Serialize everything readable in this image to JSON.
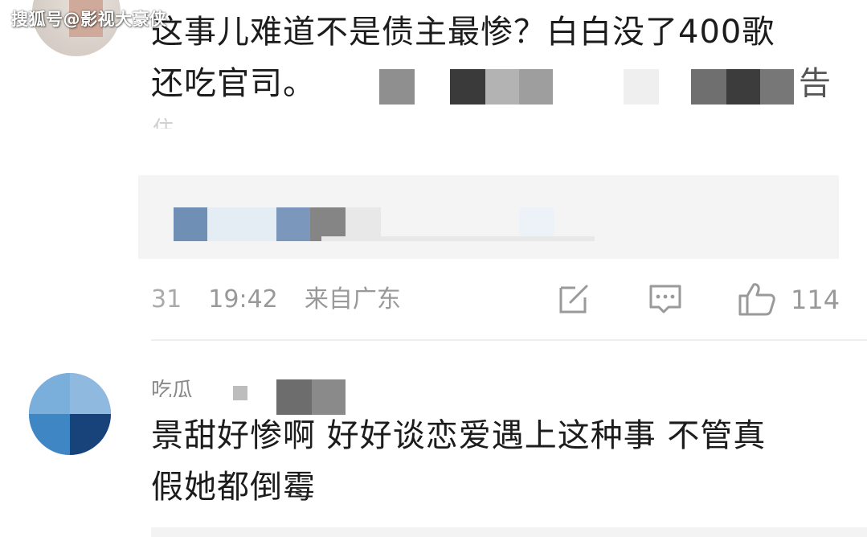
{
  "watermark": "搜狐号@影视大豪侠",
  "comment1": {
    "line1": "这事儿难道不是债主最惨？白白没了400歌",
    "line2": "还吃官司。",
    "trailing_fragment": "告",
    "faded_fragment": "住"
  },
  "comment1_meta": {
    "date_fragment": "31",
    "time": "19:42",
    "location": "来自广东",
    "like_count": "114"
  },
  "comment2": {
    "username_fragment": "吃瓜",
    "line1": "景甜好惨啊 好好谈恋爱遇上这种事 不管真",
    "line2": "假她都倒霉"
  },
  "icons": {
    "share": "edit-share-icon",
    "comment": "comment-bubble-icon",
    "like": "thumbs-up-icon"
  },
  "colors": {
    "text": "#1c1c1c",
    "meta": "#999999",
    "reply_bg": "#f4f4f4",
    "divider": "#eeeeee"
  }
}
